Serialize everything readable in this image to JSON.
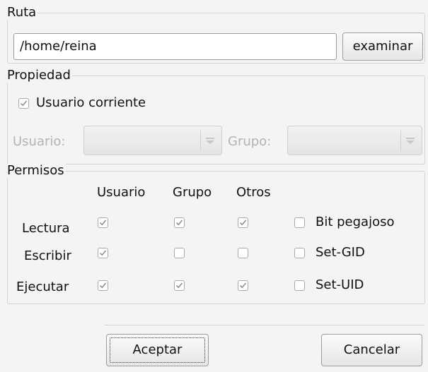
{
  "ruta": {
    "title": "Ruta",
    "path_value": "/home/reina",
    "browse_label": "examinar"
  },
  "propiedad": {
    "title": "Propiedad",
    "current_user_label": "Usuario corriente",
    "current_user_checked": true,
    "user_label": "Usuario:",
    "group_label": "Grupo:"
  },
  "permisos": {
    "title": "Permisos",
    "columns": [
      "Usuario",
      "Grupo",
      "Otros"
    ],
    "rows": [
      {
        "label": "Lectura",
        "usuario": true,
        "grupo": true,
        "otros": true,
        "special_label": "Bit pegajoso",
        "special_checked": false
      },
      {
        "label": "Escribir",
        "usuario": true,
        "grupo": false,
        "otros": false,
        "special_label": "Set-GID",
        "special_checked": false
      },
      {
        "label": "Ejecutar",
        "usuario": true,
        "grupo": true,
        "otros": true,
        "special_label": "Set-UID",
        "special_checked": false
      }
    ]
  },
  "buttons": {
    "accept_label": "Aceptar",
    "cancel_label": "Cancelar"
  }
}
